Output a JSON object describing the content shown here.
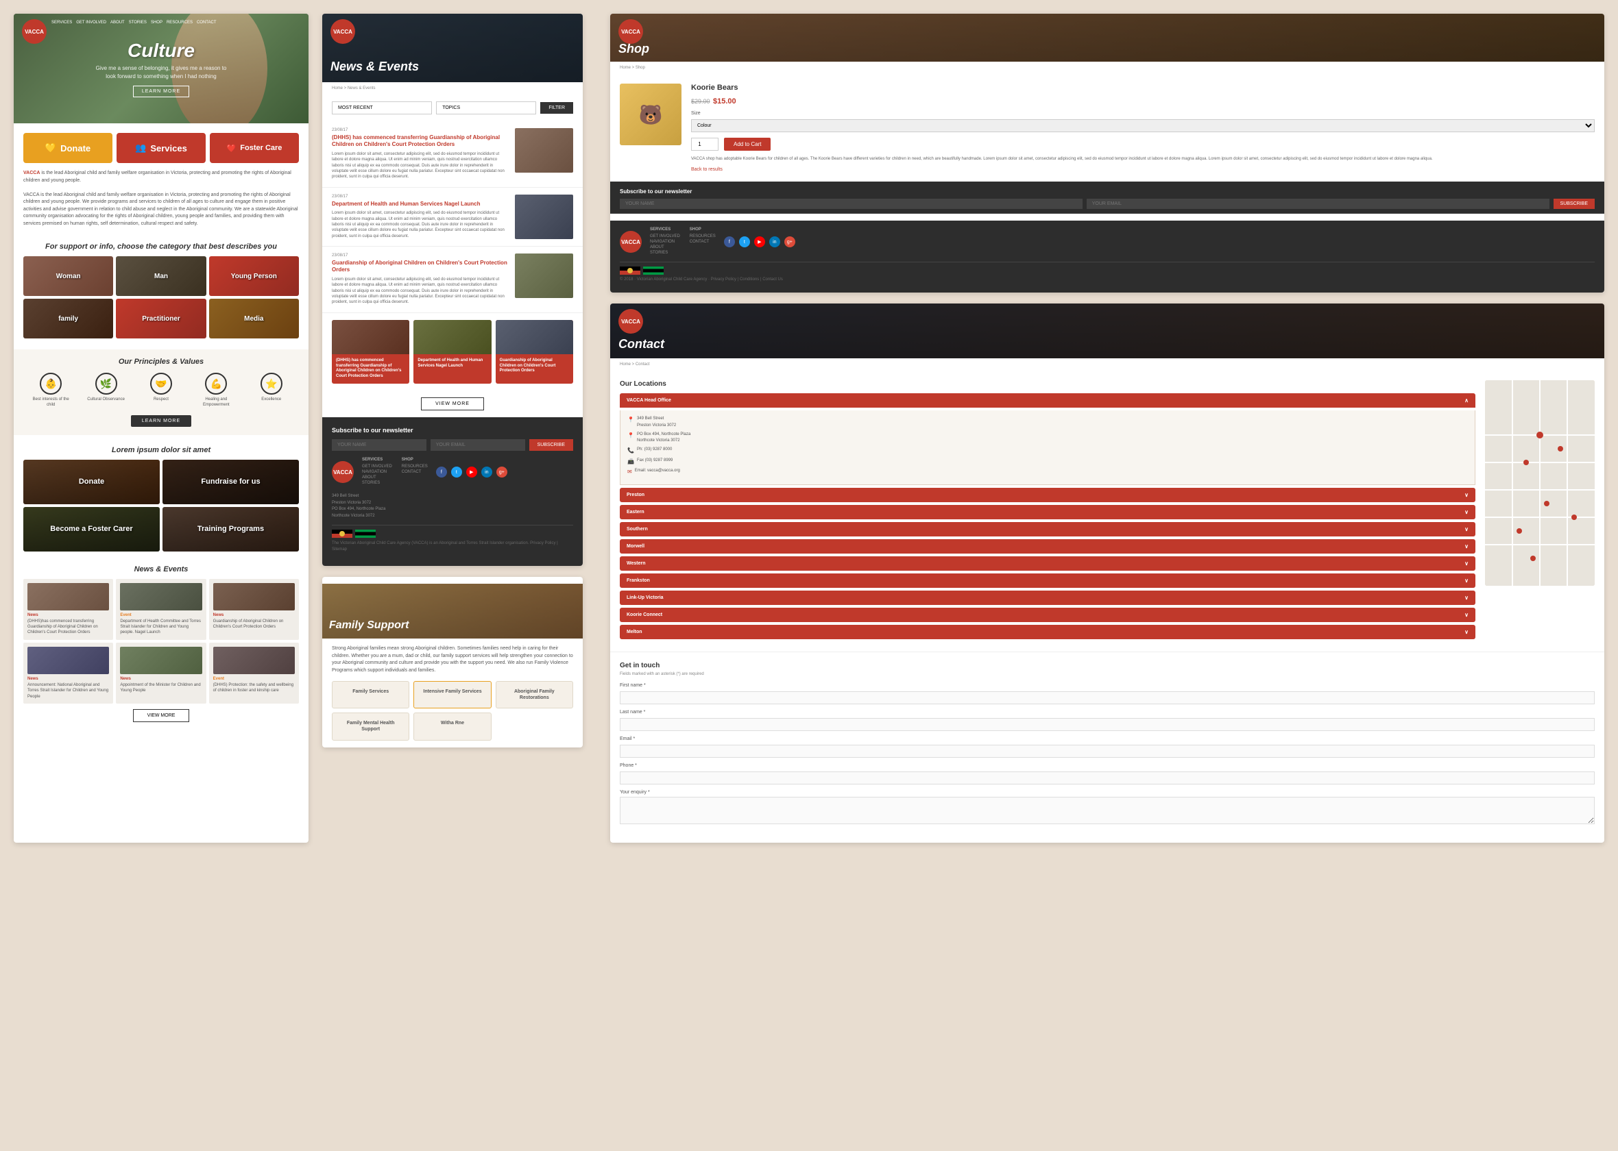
{
  "site": {
    "name": "VACCA",
    "tagline": "Victorian Aboriginal Child Care Agency"
  },
  "hero": {
    "title": "Culture",
    "subtitle": "Give me a sense of belonging, it gives me a reason to look forward to something when I had nothing",
    "cta": "LEARN MORE"
  },
  "nav": {
    "items": [
      "SERVICES",
      "GET INVOLVED",
      "ABOUT",
      "STORIES",
      "SHOP",
      "RESOURCES",
      "CONTACT"
    ]
  },
  "actions": {
    "donate": "Donate",
    "services": "Services",
    "foster": "Foster Care"
  },
  "about": {
    "text": "VACCA is the lead Aboriginal child and family welfare organisation in Victoria, protecting and promoting the rights of Aboriginal children and young people. We provide programs and services to children of all ages to culture and engage them in positive activities and advise government in relation to child abuse and neglect in the Aboriginal community. We are a statewide Aboriginal community organisation advocating for the rights of Aboriginal children, young people and families, and providing them with services premised on human rights, self determination, cultural respect and safety."
  },
  "categories_heading": "For support or info, choose the category that best describes you",
  "categories": [
    {
      "label": "Woman",
      "bg": "woman"
    },
    {
      "label": "Man",
      "bg": "man"
    },
    {
      "label": "Young Person",
      "bg": "young"
    },
    {
      "label": "family",
      "bg": "family"
    },
    {
      "label": "Practitioner",
      "bg": "practitioner"
    },
    {
      "label": "Media",
      "bg": "media"
    }
  ],
  "principles": {
    "heading": "Our Principles & Values",
    "items": [
      {
        "icon": "👶",
        "label": "Best interests of the child"
      },
      {
        "icon": "🌿",
        "label": "Cultural Observance"
      },
      {
        "icon": "🤝",
        "label": "Respect"
      },
      {
        "icon": "💪",
        "label": "Healing and Empowerment"
      },
      {
        "icon": "⭐",
        "label": "Excellence"
      }
    ],
    "learn_more": "LEARN MORE"
  },
  "support": {
    "heading": "Lorem ipsum dolor sit amet",
    "items": [
      {
        "label": "Donate",
        "bg": "donate"
      },
      {
        "label": "Fundraise for us",
        "bg": "fundraise"
      },
      {
        "label": "Become a Foster Carer",
        "bg": "foster"
      },
      {
        "label": "Training Programs",
        "bg": "training"
      }
    ]
  },
  "news_events": {
    "heading": "News & Events",
    "hero_title": "News & Events",
    "view_more": "VIEW MORE",
    "filter": {
      "most_recent_label": "MOST RECENT",
      "topics_label": "TOPICS",
      "filter_btn": "FILTER"
    },
    "articles": [
      {
        "date": "23/08/17",
        "title": "(DHHS) has commenced transferring Guardianship of Aboriginal Children on Children's Court Protection Orders",
        "body": "Lorem ipsum dolor sit amet, consectetur adipiscing elit, sed do eiusmod tempor incididunt ut labore et dolore magna aliqua. Ut enim ad minim veniam, quis nostrud exercitation ullamco laboris nisi ut aliquip ex ea commodo consequat. Duis aute irure dolor in reprehenderit in voluptate velit esse cillum dolore eu fugiat nulla pariatur. Excepteur sint occaecat cupidatat non proident, sunt in culpa qui officia deserunt.",
        "img_style": "article-img"
      },
      {
        "date": "23/08/17",
        "title": "Department of Health and Human Services Nagel Launch",
        "body": "Lorem ipsum dolor sit amet, consectetur adipiscing elit, sed do eiusmod tempor incididunt ut labore et dolore magna aliqua. Ut enim ad minim veniam, quis nostrud exercitation ullamco laboris nisi ut aliquip ex ea commodo consequat. Duis aute irure dolor in reprehenderit in voluptate velit esse cillum dolore eu fugiat nulla pariatur. Excepteur sint occaecat cupidatat non proident, sunt in culpa qui officia deserunt.",
        "img_style": "article-img article-img-2"
      },
      {
        "date": "23/08/17",
        "title": "Guardianship of Aboriginal Children on Children's Court Protection Orders",
        "body": "Lorem ipsum dolor sit amet, consectetur adipiscing elit, sed do eiusmod tempor incididunt ut labore et dolore magna aliqua. Ut enim ad minim veniam, quis nostrud exercitation ullamco laboris nisi ut aliquip ex ea commodo consequat. Duis aute irure dolor in reprehenderit in voluptate velit esse cillum dolore eu fugiat nulla pariatur. Excepteur sint occaecat cupidatat non proident, sunt in culpa qui officia deserunt.",
        "img_style": "article-img article-img-3"
      }
    ],
    "small_cards": [
      {
        "title": "(DHHS) has commenced transferring Guardianship of Aboriginal Children on Children's Court Protection Orders"
      },
      {
        "title": "Department of Health and Human Services Nagel Launch"
      },
      {
        "title": "Guardianship of Aboriginal Children on Children's Court Protection Orders"
      }
    ]
  },
  "newsletter": {
    "title": "Subscribe to our newsletter",
    "name_placeholder": "YOUR NAME",
    "email_placeholder": "YOUR EMAIL",
    "subscribe_btn": "SUBSCRIBE"
  },
  "footer": {
    "address_lines": [
      "349 Bell Street",
      "Preston Victoria 3072",
      "PO Box 494, Northcote Plaza",
      "Northcote Victoria 3072"
    ],
    "services_links": [
      "SERVICES",
      "GET INVOLVED",
      "NAVIGATION",
      "ABOUT",
      "STORIES"
    ],
    "shop_links": [
      "SHOP",
      "RESOURCES",
      "CONTACT"
    ],
    "social_icons": [
      "f",
      "t",
      "y",
      "in",
      "g+"
    ]
  },
  "shop": {
    "title": "Shop",
    "breadcrumb": "Home > Shop",
    "product": {
      "name": "Koorie Bears",
      "price_old": "$29.00",
      "price_new": "$15.00",
      "size_label": "Size",
      "size_placeholder": "Colour",
      "qty_label": "1",
      "add_cart_btn": "Add to Cart",
      "description": "VACCA shop has adoptable Koorie Bears for children of all ages. The Koorie Bears have different varieties for children in need, which are beautifully handmade. Lorem ipsum dolor sit amet, consectetur adipiscing elit, sed do eiusmod tempor incididunt ut labore et dolore magna aliqua. Lorem ipsum dolor sit amet, consectetur adipiscing elit, sed do eiusmod tempor incididunt ut labore et dolore magna aliqua.",
      "back_text": "Back to results"
    }
  },
  "contact": {
    "title": "Contact",
    "breadcrumb": "Home > Contact",
    "locations_heading": "Our Locations",
    "head_office": {
      "name": "VACCA Head Office",
      "address": "349 Bell Street",
      "suburb": "Preston Victoria 3072",
      "po_box": "PO Box 494, Northcote Plaza",
      "northcote": "Northcote Victoria 3072",
      "phone": "Ph: (03) 9287 8000",
      "fax": "Fax (03) 9287 8999",
      "email": "Email: vacca@vacca.org"
    },
    "other_locations": [
      "Preston",
      "Eastern",
      "Southern",
      "Morwell",
      "Western",
      "Frankston",
      "Link-Up Victoria",
      "Koorie Connect",
      "Melton"
    ],
    "get_in_touch": {
      "heading": "Get in touch",
      "subtext": "Fields marked with an asterisk (*) are required",
      "fields": [
        {
          "label": "First name *",
          "type": "text"
        },
        {
          "label": "Last name *",
          "type": "text"
        },
        {
          "label": "Email *",
          "type": "email"
        },
        {
          "label": "Phone *",
          "type": "tel"
        },
        {
          "label": "Your enquiry *",
          "type": "textarea"
        }
      ]
    }
  },
  "family_support": {
    "hero_title": "Family Support",
    "intro": "Strong Aboriginal families mean strong Aboriginal children. Sometimes families need help in caring for their children. Whether you are a mum, dad or child, our family support services will help strengthen your connection to your Aboriginal community and culture and provide you with the support you need. We also run Family Violence Programs which support individuals and families.",
    "services": [
      {
        "label": "Family Services"
      },
      {
        "label": "Intensive Family Services"
      },
      {
        "label": "Aboriginal Family Restorations"
      },
      {
        "label": "Family Mental Health Support"
      },
      {
        "label": "Witha Rne"
      }
    ]
  }
}
